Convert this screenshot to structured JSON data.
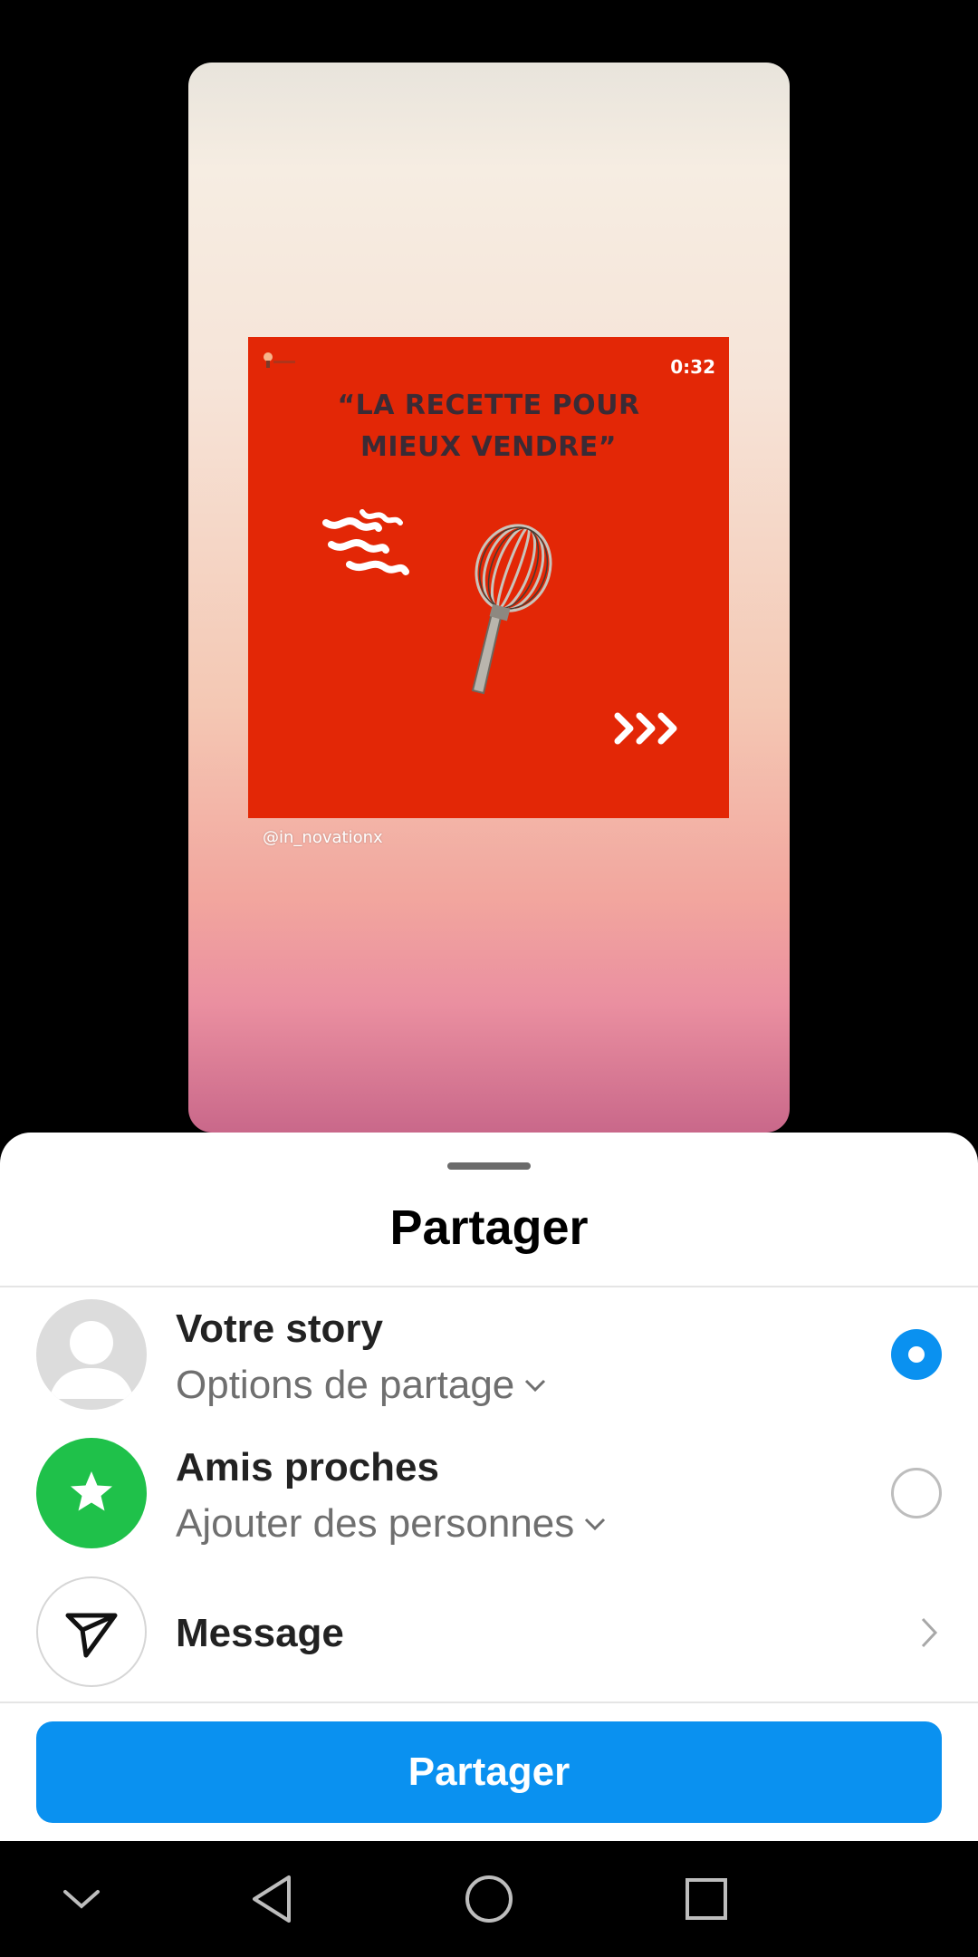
{
  "preview": {
    "timer": "0:32",
    "headline_line1": "“LA RECETTE POUR",
    "headline_line2": "MIEUX VENDRE”",
    "handle": "@in_novationx",
    "icons": [
      "logo-icon",
      "steam-icon",
      "whisk-icon",
      "arrows-icon"
    ]
  },
  "sheet": {
    "title": "Partager",
    "options": [
      {
        "title": "Votre story",
        "subtitle": "Options de partage",
        "selected": true,
        "icon": "profile-avatar-icon"
      },
      {
        "title": "Amis proches",
        "subtitle": "Ajouter des personnes",
        "selected": false,
        "icon": "star-icon"
      },
      {
        "title": "Message",
        "icon": "paper-plane-icon"
      }
    ],
    "button_label": "Partager"
  },
  "colors": {
    "accent": "#0a91f0",
    "close_friends_green": "#1fc14a",
    "post_red": "#e32706"
  },
  "navbar": {
    "icons": [
      "chevron-down-icon",
      "back-icon",
      "home-icon",
      "recents-icon"
    ]
  }
}
